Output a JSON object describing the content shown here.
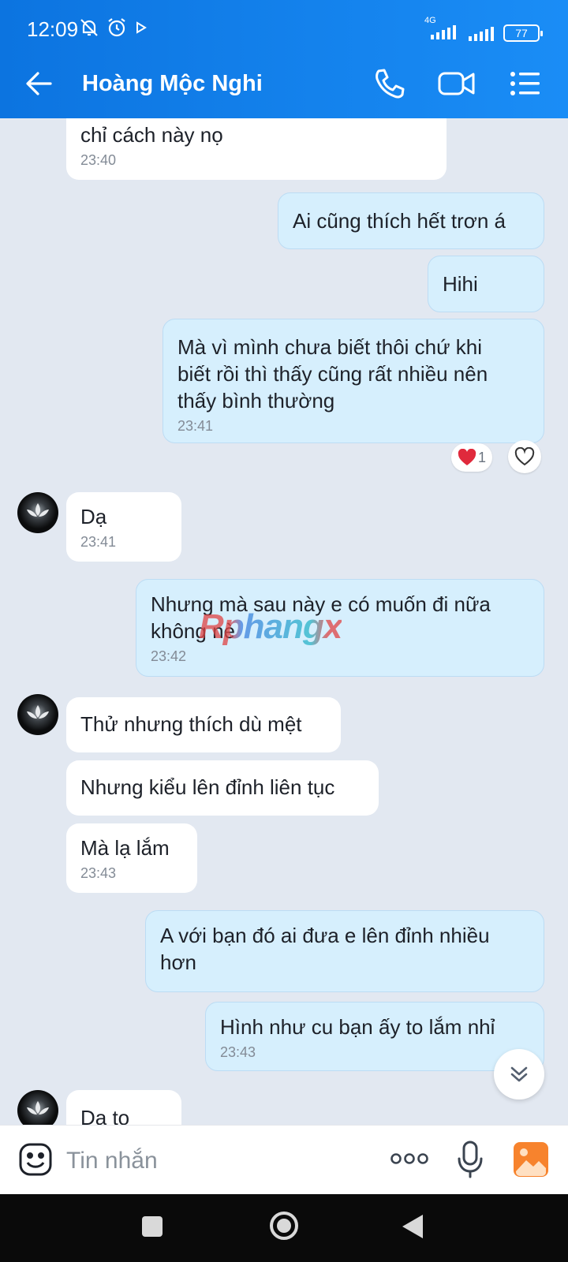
{
  "status": {
    "time": "12:09",
    "network": "4G",
    "battery": "77"
  },
  "header": {
    "contact_name": "Hoàng Mộc Nghi",
    "icons": [
      "back-arrow-icon",
      "phone-icon",
      "video-call-icon",
      "menu-list-icon"
    ]
  },
  "messages": [
    {
      "side": "in",
      "text": "chỉ cách này nọ",
      "time": "23:40"
    },
    {
      "side": "out",
      "text": "Ai cũng thích hết trơn á",
      "time": ""
    },
    {
      "side": "out",
      "text": "Hihi",
      "time": ""
    },
    {
      "side": "out",
      "text": "Mà vì mình chưa biết thôi chứ khi\nbiết rồi thì thấy cũng rất nhiều nên\nthấy bình thường",
      "time": "23:41",
      "reaction_count": "1"
    },
    {
      "side": "in",
      "text": "Dạ",
      "time": "23:41"
    },
    {
      "side": "out",
      "text": "Nhưng mà sau này e có muốn đi nữa\nkhông nè",
      "time": "23:42"
    },
    {
      "side": "in",
      "text": "Thử nhưng thích dù mệt",
      "time": ""
    },
    {
      "side": "in",
      "text": "Nhưng kiểu lên đỉnh liên tục",
      "time": ""
    },
    {
      "side": "in",
      "text": "Mà lạ lắm",
      "time": "23:43"
    },
    {
      "side": "out",
      "text": "A với bạn đó ai đưa e lên đỉnh nhiều\nhơn",
      "time": ""
    },
    {
      "side": "out",
      "text": "Hình như cu bạn ấy to lắm nhỉ",
      "time": "23:43"
    },
    {
      "side": "in",
      "text": "Dạ to",
      "time": ""
    }
  ],
  "watermark": "Rphangx",
  "input": {
    "placeholder": "Tin nhắn"
  },
  "colors": {
    "header_blue": "#1a8df6",
    "outgoing_bubble": "#d6effd",
    "incoming_bubble": "#ffffff",
    "chat_background": "#e2e8f1"
  }
}
